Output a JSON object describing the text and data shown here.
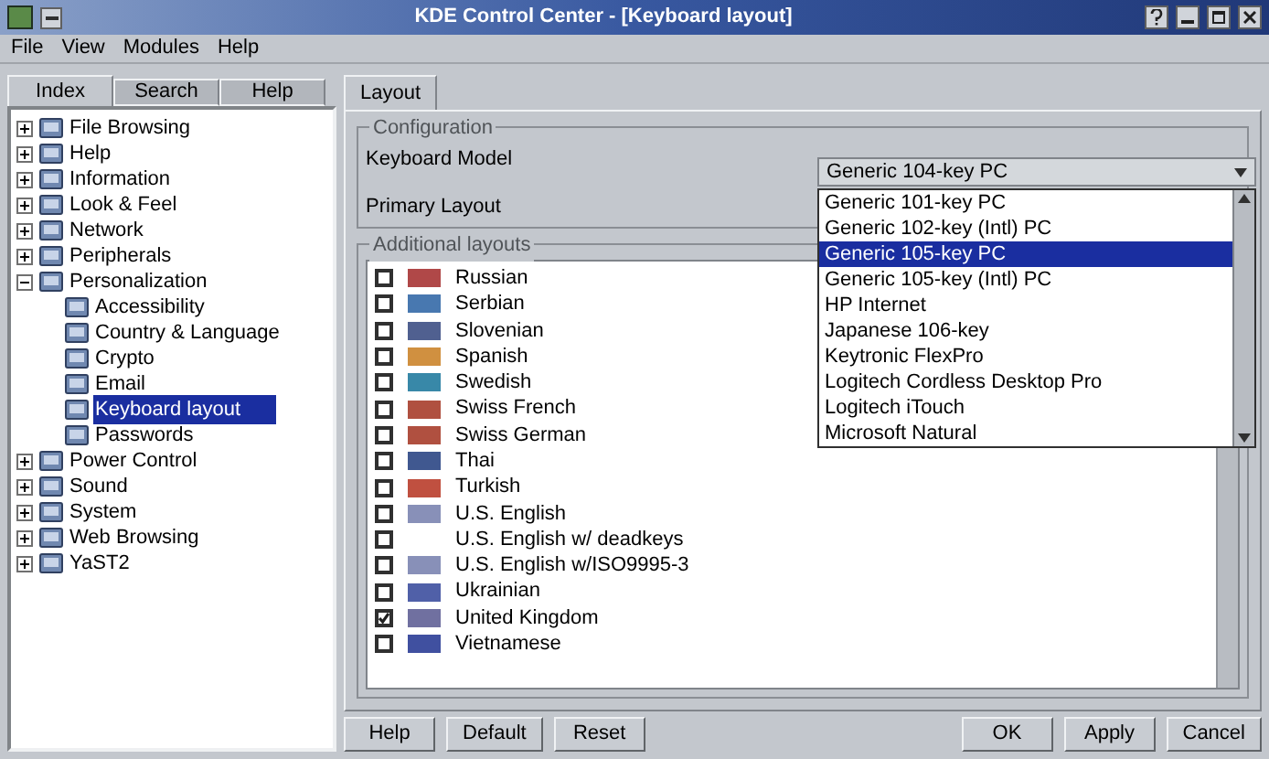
{
  "window": {
    "title": "KDE Control Center - [Keyboard layout]"
  },
  "menu": [
    "File",
    "View",
    "Modules",
    "Help"
  ],
  "sidebar": {
    "tabs": [
      {
        "label": "Index",
        "selected": true
      },
      {
        "label": "Search",
        "selected": false
      },
      {
        "label": "Help",
        "selected": false
      }
    ],
    "tree": [
      {
        "label": "File Browsing",
        "expanded": false,
        "selected": false
      },
      {
        "label": "Help",
        "expanded": false,
        "selected": false
      },
      {
        "label": "Information",
        "expanded": false,
        "selected": false
      },
      {
        "label": "Look & Feel",
        "expanded": false,
        "selected": false
      },
      {
        "label": "Network",
        "expanded": false,
        "selected": false
      },
      {
        "label": "Peripherals",
        "expanded": false,
        "selected": false
      },
      {
        "label": "Personalization",
        "expanded": true,
        "selected": false,
        "children": [
          {
            "label": "Accessibility",
            "selected": false
          },
          {
            "label": "Country & Language",
            "selected": false
          },
          {
            "label": "Crypto",
            "selected": false
          },
          {
            "label": "Email",
            "selected": false
          },
          {
            "label": "Keyboard layout",
            "selected": true
          },
          {
            "label": "Passwords",
            "selected": false
          }
        ]
      },
      {
        "label": "Power Control",
        "expanded": false,
        "selected": false
      },
      {
        "label": "Sound",
        "expanded": false,
        "selected": false
      },
      {
        "label": "System",
        "expanded": false,
        "selected": false
      },
      {
        "label": "Web Browsing",
        "expanded": false,
        "selected": false
      },
      {
        "label": "YaST2",
        "expanded": false,
        "selected": false
      }
    ]
  },
  "content": {
    "tabs": [
      {
        "label": "Layout",
        "selected": true
      }
    ],
    "configuration": {
      "title": "Configuration",
      "fields": [
        {
          "label": "Keyboard Model"
        },
        {
          "label": "Primary Layout"
        }
      ]
    },
    "keyboard_model": {
      "value": "Generic 104-key PC",
      "options": [
        {
          "label": "Generic 101-key PC",
          "selected": false
        },
        {
          "label": "Generic 102-key (Intl) PC",
          "selected": false
        },
        {
          "label": "Generic 105-key PC",
          "selected": true
        },
        {
          "label": "Generic 105-key (Intl) PC",
          "selected": false
        },
        {
          "label": "HP Internet",
          "selected": false
        },
        {
          "label": "Japanese 106-key",
          "selected": false
        },
        {
          "label": "Keytronic FlexPro",
          "selected": false
        },
        {
          "label": "Logitech Cordless Desktop Pro",
          "selected": false
        },
        {
          "label": "Logitech iTouch",
          "selected": false
        },
        {
          "label": "Microsoft Natural",
          "selected": false
        }
      ]
    },
    "additional_layouts": {
      "title": "Additional layouts",
      "items": [
        {
          "label": "Russian",
          "checked": false,
          "color": "#b04848"
        },
        {
          "label": "Serbian",
          "checked": false,
          "color": "#4878b0"
        },
        {
          "label": "Slovenian",
          "checked": false,
          "color": "#506090"
        },
        {
          "label": "Spanish",
          "checked": false,
          "color": "#d09040"
        },
        {
          "label": "Swedish",
          "checked": false,
          "color": "#3888a8"
        },
        {
          "label": "Swiss French",
          "checked": false,
          "color": "#b05040"
        },
        {
          "label": "Swiss German",
          "checked": false,
          "color": "#b05040"
        },
        {
          "label": "Thai",
          "checked": false,
          "color": "#405890"
        },
        {
          "label": "Turkish",
          "checked": false,
          "color": "#c05040"
        },
        {
          "label": "U.S. English",
          "checked": false,
          "color": "#8890b8"
        },
        {
          "label": "U.S. English w/ deadkeys",
          "checked": false
        },
        {
          "label": "U.S. English w/ISO9995-3",
          "checked": false,
          "color": "#8890b8"
        },
        {
          "label": "Ukrainian",
          "checked": false,
          "color": "#5060a8"
        },
        {
          "label": "United Kingdom",
          "checked": true,
          "color": "#7070a0"
        },
        {
          "label": "Vietnamese",
          "checked": false,
          "color": "#4050a0"
        }
      ]
    },
    "buttons_left": [
      "Help",
      "Default",
      "Reset"
    ],
    "buttons_right": [
      "OK",
      "Apply",
      "Cancel"
    ]
  }
}
